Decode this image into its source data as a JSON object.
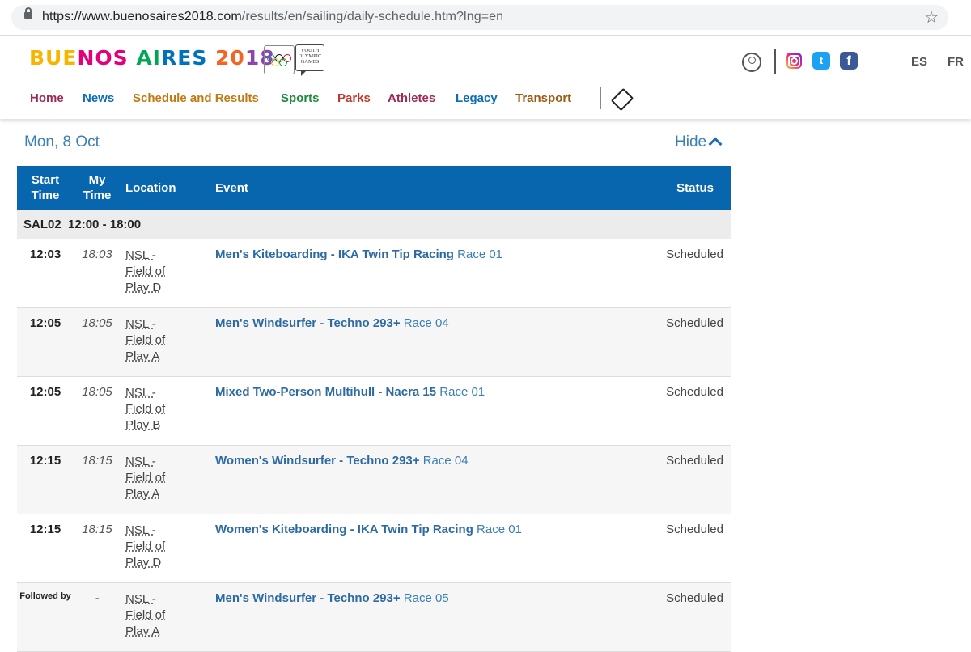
{
  "browser": {
    "url_host": "https://www.buenosaires2018.com",
    "url_path": "/results/en/sailing/daily-schedule.htm?lng=en"
  },
  "header": {
    "logo_parts": [
      "BUE",
      "NOS",
      " AI",
      "RES",
      " 20",
      "18"
    ],
    "yog_text": "YOUTH OLYMPIC GAMES",
    "languages": [
      "ES",
      "FR"
    ],
    "nav": [
      {
        "label": "Home",
        "color": "#9b2b57"
      },
      {
        "label": "News",
        "color": "#0d6fb2"
      },
      {
        "label": "Schedule and Results",
        "color": "#c07a13"
      },
      {
        "label": "Sports",
        "color": "#1f8a3d"
      },
      {
        "label": "Parks",
        "color": "#c0392b"
      },
      {
        "label": "Athletes",
        "color": "#9b2b57"
      },
      {
        "label": "Legacy",
        "color": "#0d6fb2"
      },
      {
        "label": "Transport",
        "color": "#9c5a13"
      }
    ]
  },
  "schedule": {
    "date": "Mon, 8 Oct",
    "hide_label": "Hide",
    "columns": [
      "Start Time",
      "My Time",
      "Location",
      "Event",
      "Status"
    ],
    "group": {
      "code": "SAL02",
      "time": "12:00 - 18:00"
    },
    "rows": [
      {
        "start": "12:03",
        "my": "18:03",
        "loc": [
          "NSL -",
          "Field of",
          "Play D"
        ],
        "event": "Men's Kiteboarding - IKA Twin Tip Racing",
        "race": "Race 01",
        "status": "Scheduled"
      },
      {
        "start": "12:05",
        "my": "18:05",
        "loc": [
          "NSL -",
          "Field of",
          "Play A"
        ],
        "event": "Men's Windsurfer - Techno 293+",
        "race": "Race 04",
        "status": "Scheduled"
      },
      {
        "start": "12:05",
        "my": "18:05",
        "loc": [
          "NSL -",
          "Field of",
          "Play B"
        ],
        "event": "Mixed Two-Person Multihull - Nacra 15",
        "race": "Race 01",
        "status": "Scheduled"
      },
      {
        "start": "12:15",
        "my": "18:15",
        "loc": [
          "NSL -",
          "Field of",
          "Play A"
        ],
        "event": "Women's Windsurfer - Techno 293+",
        "race": "Race 04",
        "status": "Scheduled"
      },
      {
        "start": "12:15",
        "my": "18:15",
        "loc": [
          "NSL -",
          "Field of",
          "Play D"
        ],
        "event": "Women's Kiteboarding - IKA Twin Tip Racing",
        "race": "Race 01",
        "status": "Scheduled"
      },
      {
        "start": "Followed by",
        "my": "-",
        "loc": [
          "NSL -",
          "Field of",
          "Play A"
        ],
        "event": "Men's Windsurfer - Techno 293+",
        "race": "Race 05",
        "status": "Scheduled"
      }
    ]
  }
}
